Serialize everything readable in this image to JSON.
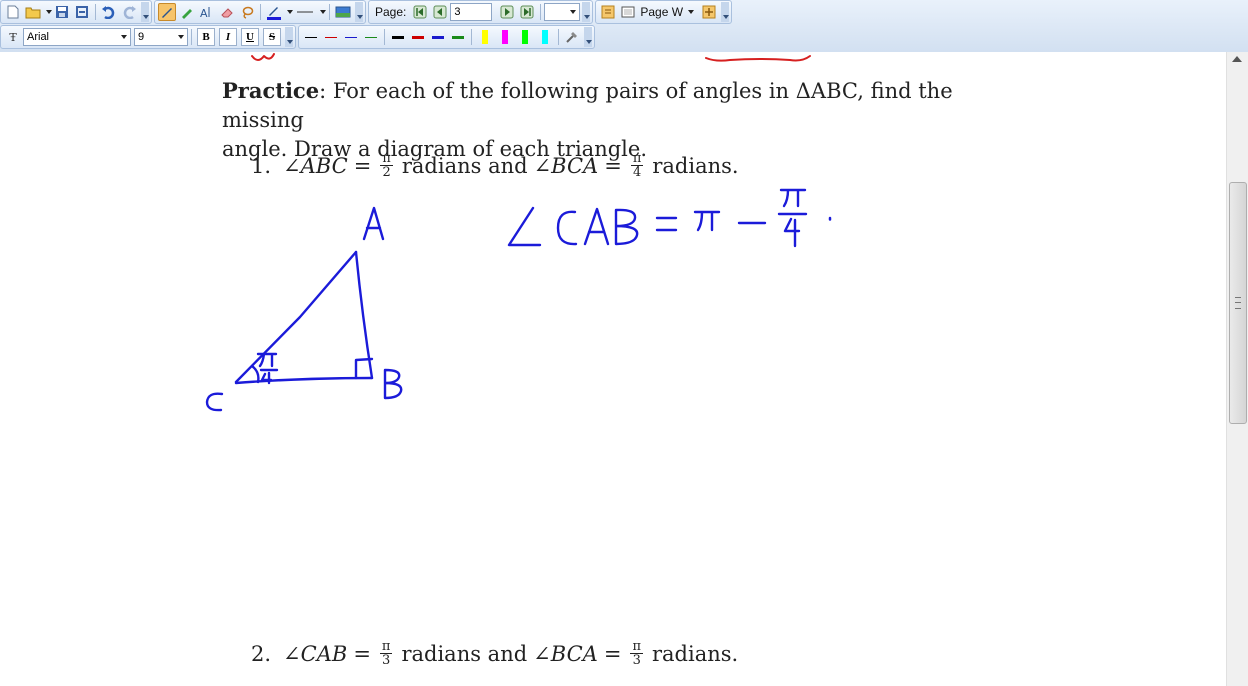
{
  "toolbar": {
    "page_label": "Page:",
    "page_number": "3",
    "view_mode": "Page W",
    "font_name": "Arial",
    "font_size": "9",
    "bold": "B",
    "italic": "I",
    "underline": "U",
    "strike": "S",
    "font_icon_glyph": "Ŧ",
    "highlight_colors": [
      "#ffff00",
      "#ff00ff",
      "#00ff00",
      "#00ffff"
    ],
    "pen_colors": [
      "#000000",
      "#cc0000",
      "#1a1acc",
      "#1a8a1a"
    ]
  },
  "document": {
    "practice_heading": "Practice",
    "practice_text": ": For each of the following pairs of angles in ΔABC, find the missing",
    "practice_text_line2": "angle. Draw a diagram of each triangle.",
    "problem1": {
      "number": "1.",
      "angle1": "∠ABC",
      "eq": "=",
      "frac1_num": "π",
      "frac1_den": "2",
      "word1": "radians and",
      "angle2": "∠BCA",
      "frac2_num": "π",
      "frac2_den": "4",
      "word2": "radians."
    },
    "problem2": {
      "number": "2.",
      "angle1": "∠CAB",
      "eq": "=",
      "frac1_num": "π",
      "frac1_den": "3",
      "word1": "radians and",
      "angle2": "∠BCA",
      "frac2_num": "π",
      "frac2_den": "3",
      "word2": "radians."
    }
  },
  "handwriting": {
    "vertex_a": "A",
    "vertex_b": "B",
    "vertex_c": "C",
    "angle_c_mark": "π/4",
    "equation": "∠CAB = π − π/4 .",
    "ink_color": "#1b1bd9",
    "red_ink_color": "#d62020"
  }
}
